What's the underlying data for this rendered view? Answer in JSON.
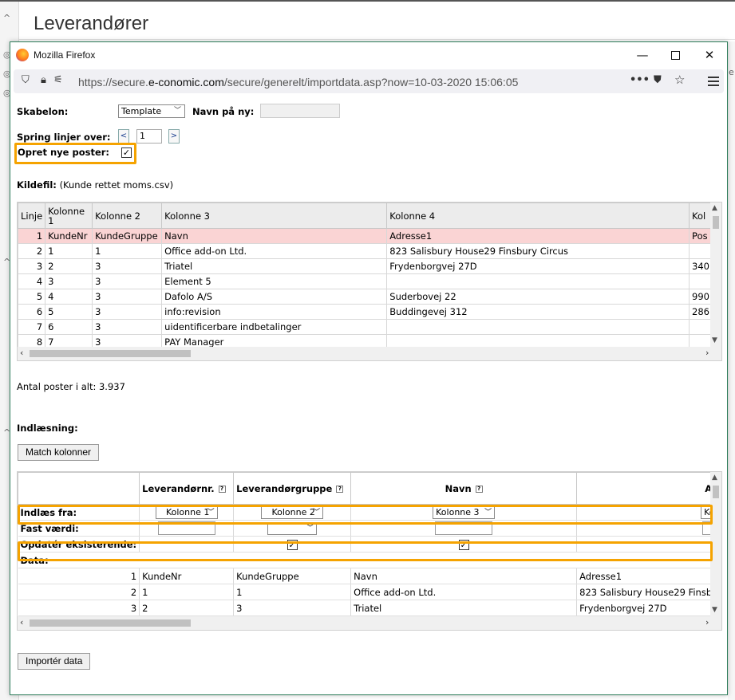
{
  "background": {
    "page_title": "Leverandører",
    "right_edge_char": "e"
  },
  "window": {
    "title": "Mozilla Firefox",
    "url_prefix": "https://secure.",
    "url_domain": "e-conomic.com",
    "url_rest": "/secure/generelt/importdata.asp?now=10-03-2020 15:06:05"
  },
  "form": {
    "skabelon_label": "Skabelon:",
    "skabelon_value": "Template",
    "navn_label": "Navn på ny:",
    "navn_value": "",
    "spring_label": "Spring linjer over:",
    "spring_prev": "<",
    "spring_value": "1",
    "spring_next": ">",
    "opret_label": "Opret nye poster:",
    "opret_checked": "✓",
    "kildefil_label": "Kildefil:",
    "kildefil_value": "(Kunde rettet moms.csv)"
  },
  "source_grid": {
    "headers": [
      "Linje",
      "Kolonne 1",
      "Kolonne 2",
      "Kolonne 3",
      "Kolonne 4",
      "Kol"
    ],
    "rows": [
      [
        "1",
        "KundeNr",
        "KundeGruppe",
        "Navn",
        "Adresse1",
        "Pos"
      ],
      [
        "2",
        "1",
        "1",
        "Office add-on Ltd.",
        "823 Salisbury House29 Finsbury Circus",
        ""
      ],
      [
        "3",
        "2",
        "3",
        "Triatel",
        "Frydenborgvej 27D",
        "340"
      ],
      [
        "4",
        "3",
        "3",
        "Element 5",
        "",
        ""
      ],
      [
        "5",
        "4",
        "3",
        "Dafolo A/S",
        "Suderbovej 22",
        "990"
      ],
      [
        "6",
        "5",
        "3",
        "info:revision",
        "Buddingevej 312",
        "286"
      ],
      [
        "7",
        "6",
        "3",
        "uidentificerbare indbetalinger",
        "",
        ""
      ],
      [
        "8",
        "7",
        "3",
        "PAY Manager",
        "",
        ""
      ]
    ]
  },
  "summary": {
    "antal_text": "Antal poster i alt: 3.937",
    "indlaesning_label": "Indlæsning:",
    "match_button": "Match kolonner"
  },
  "mapping_grid": {
    "headers": [
      "",
      "Leverandørnr.",
      "Leverandørgruppe",
      "Navn",
      "A"
    ],
    "indlaes_label": "Indlæs fra:",
    "indlaes_values": [
      "Kolonne 1",
      "Kolonne 2",
      "Kolonne 3",
      "Ko"
    ],
    "fast_label": "Fast værdi:",
    "opdater_label": "Opdatér eksisterende:",
    "opdater_checks": [
      "",
      "✓",
      "✓",
      ""
    ],
    "data_label": "Data:",
    "data_rows": [
      [
        "1",
        "KundeNr",
        "KundeGruppe",
        "Navn",
        "Adresse1"
      ],
      [
        "2",
        "1",
        "1",
        "Office add-on Ltd.",
        "823 Salisbury House29 Finsb"
      ],
      [
        "3",
        "2",
        "3",
        "Triatel",
        "Frydenborgvej 27D"
      ]
    ]
  },
  "footer": {
    "import_button": "Importér data"
  }
}
